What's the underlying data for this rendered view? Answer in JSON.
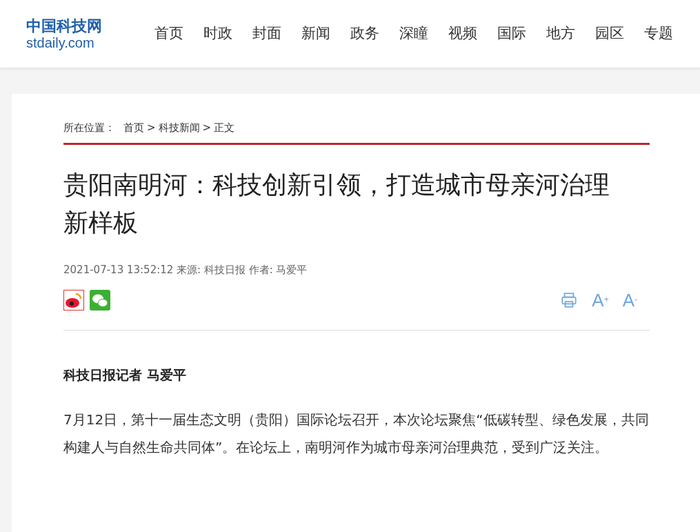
{
  "logo": {
    "name": "中国科技网",
    "domain": "stdaily.com"
  },
  "nav": [
    {
      "label": "首页"
    },
    {
      "label": "时政"
    },
    {
      "label": "封面"
    },
    {
      "label": "新闻"
    },
    {
      "label": "政务"
    },
    {
      "label": "深瞳"
    },
    {
      "label": "视频"
    },
    {
      "label": "国际"
    },
    {
      "label": "地方"
    },
    {
      "label": "园区"
    },
    {
      "label": "专题"
    }
  ],
  "breadcrumb": {
    "label": "所在位置：",
    "separator": ">",
    "items": [
      "首页",
      "科技新闻",
      "正文"
    ]
  },
  "article": {
    "title": "贵阳南明河：科技创新引领，打造城市母亲河治理新样板",
    "meta": "2021-07-13 13:52:12 来源: 科技日报 作者: 马爱平",
    "tools": [
      {
        "kind": "print"
      },
      {
        "kind": "font",
        "letter": "A",
        "sign": "+"
      },
      {
        "kind": "font",
        "letter": "A",
        "sign": "-"
      }
    ],
    "byline": "科技日报记者 马爱平",
    "paragraphs": [
      "7月12日，第十一届生态文明（贵阳）国际论坛召开，本次论坛聚焦“低碳转型、绿色发展，共同构建人与自然生命共同体”。在论坛上，南明河作为城市母亲河治理典范，受到广泛关注。"
    ]
  }
}
